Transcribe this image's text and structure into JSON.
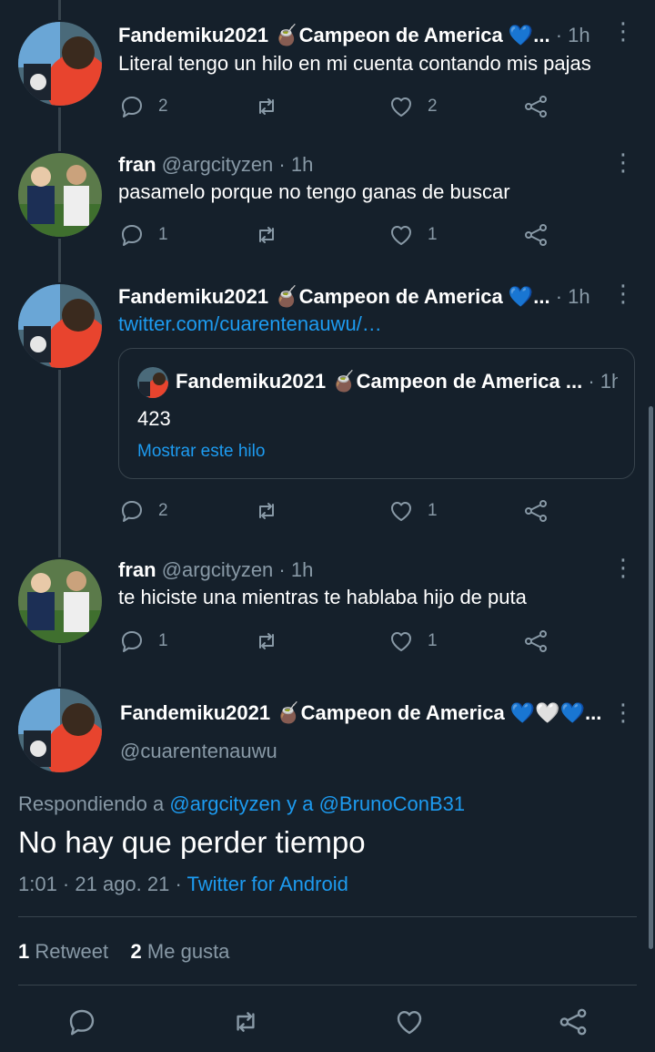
{
  "thread": [
    {
      "author": "Fandemiku2021 🧉Campeon de America 💙...",
      "time": "· 1h",
      "text": "Literal tengo un hilo en mi cuenta contando mis pajas",
      "replies": "2",
      "retweets": "",
      "likes": "2"
    },
    {
      "author": "fran",
      "handle": "@argcityzen",
      "time": "· 1h",
      "text": "pasamelo porque no tengo ganas de buscar",
      "replies": "1",
      "retweets": "",
      "likes": "1"
    },
    {
      "author": "Fandemiku2021 🧉Campeon de America 💙...",
      "time": "· 1h",
      "text": "twitter.com/cuarentenauwu/…",
      "quote": {
        "author": "Fandemiku2021 🧉Campeon de America ...",
        "time": "· 1h",
        "text": "423",
        "show_thread": "Mostrar este hilo"
      },
      "replies": "2",
      "retweets": "",
      "likes": "1"
    },
    {
      "author": "fran",
      "handle": "@argcityzen",
      "time": "· 1h",
      "text": "te hiciste una mientras te hablaba hijo de puta",
      "replies": "1",
      "retweets": "",
      "likes": "1"
    }
  ],
  "main": {
    "author": "Fandemiku2021 🧉Campeon de America 💙🤍💙...",
    "handle": "@cuarentenauwu",
    "replying_prefix": "Respondiendo a",
    "replying_user1": "@argcityzen",
    "replying_and": "y a",
    "replying_user2": "@BrunoConB31",
    "text": "No hay que perder tiempo",
    "datetime": "1:01 · 21 ago. 21 ·",
    "source": "Twitter for Android",
    "retweet_count": "1",
    "retweet_label": "Retweet",
    "like_count": "2",
    "like_label": "Me gusta"
  },
  "icons": {
    "reply": "reply-icon",
    "retweet": "retweet-icon",
    "like": "heart-icon",
    "share": "share-icon",
    "more": "more-vertical-icon"
  },
  "colors": {
    "background": "#15202b",
    "link": "#1d9bf0",
    "secondary": "#8899a6",
    "divider": "#38444d"
  }
}
